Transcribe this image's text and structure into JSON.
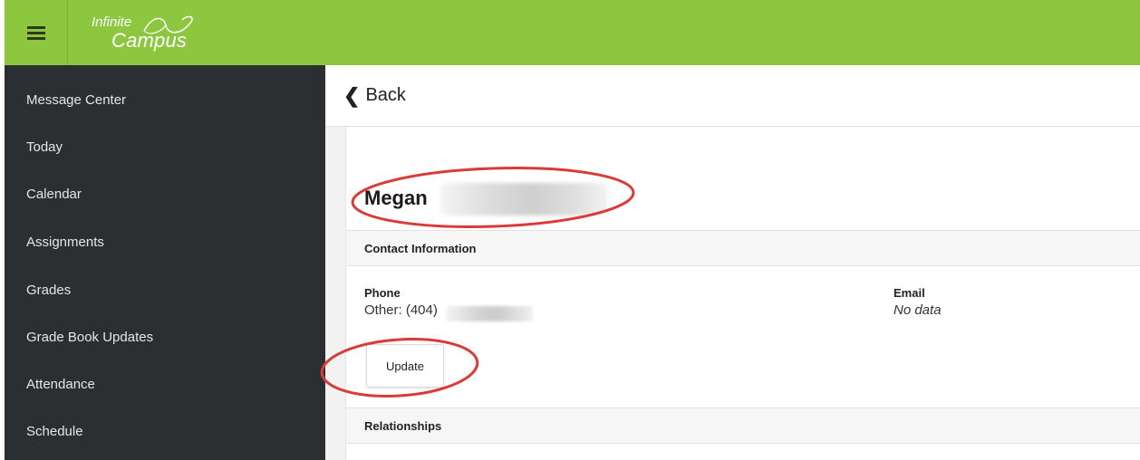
{
  "header": {
    "menu_icon": "hamburger-icon",
    "logo_line1": "Infinite",
    "logo_line2": "Campus",
    "accent": "#8dc63f"
  },
  "sidebar": {
    "items": [
      {
        "label": "Message Center"
      },
      {
        "label": "Today"
      },
      {
        "label": "Calendar"
      },
      {
        "label": "Assignments"
      },
      {
        "label": "Grades"
      },
      {
        "label": "Grade Book Updates"
      },
      {
        "label": "Attendance"
      },
      {
        "label": "Schedule"
      }
    ]
  },
  "main": {
    "back_icon": "chevron-left-icon",
    "back_label": "Back",
    "person_name": "Megan",
    "contact_section": "Contact Information",
    "phone_label": "Phone",
    "phone_value": "Other: (404)",
    "email_label": "Email",
    "email_value": "No data",
    "update_label": "Update",
    "relationships_section": "Relationships"
  },
  "annotation_color": "#d93a3a"
}
